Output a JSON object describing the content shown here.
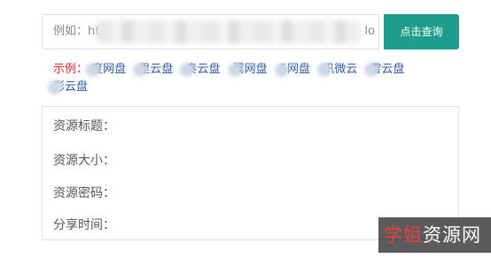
{
  "search": {
    "input_value_prefix": "例如：ht",
    "input_value_suffix": "lo",
    "button_label": "点击查询"
  },
  "examples": {
    "prefix": "示例：",
    "items": [
      "度网盘",
      "里云盘",
      "奏云盘",
      "翼网盘",
      "5网盘",
      "讯微云",
      "雷云盘",
      "彩云盘"
    ]
  },
  "info": {
    "title_label": "资源标题：",
    "size_label": "资源大小：",
    "password_label": "资源密码：",
    "share_time_label": "分享时间："
  },
  "watermark": {
    "part1": "学姐",
    "part2": "资源网"
  },
  "colors": {
    "accent": "#1f9d8c",
    "example_prefix": "#e02424",
    "example_link": "#2f5aa8"
  }
}
